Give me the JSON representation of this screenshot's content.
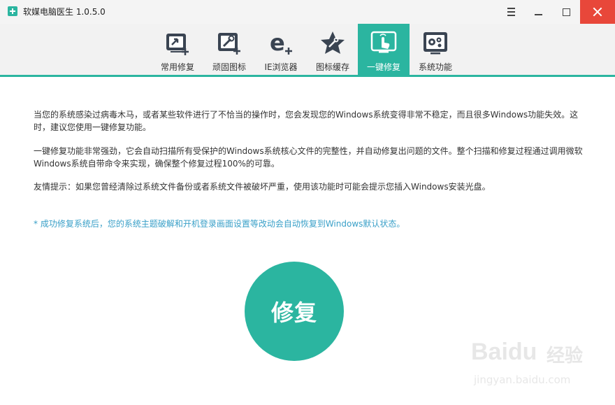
{
  "window": {
    "title": "软媒电脑医生 1.0.5.0",
    "icon": "medical-kit-icon",
    "controls": [
      "menu-icon",
      "minimize-icon",
      "maximize-icon",
      "close-icon"
    ]
  },
  "toolbar": {
    "active_tab": "一键修复",
    "accent_color": "#2bb5a0",
    "tabs": [
      {
        "label": "常用修复",
        "icon": "monitor-plus-icon"
      },
      {
        "label": "顽固图标",
        "icon": "wrench-plus-icon"
      },
      {
        "label": "IE浏览器",
        "icon": "ie-plus-icon"
      },
      {
        "label": "图标缓存",
        "icon": "star-wrench-icon"
      },
      {
        "label": "一键修复",
        "icon": "hand-click-icon"
      },
      {
        "label": "系统功能",
        "icon": "gears-icon"
      }
    ]
  },
  "content": {
    "paragraph1": "当您的系统感染过病毒木马，或者某些软件进行了不恰当的操作时，您会发现您的Windows系统变得非常不稳定，而且很多Windows功能失效。这时，建议您使用一键修复功能。",
    "paragraph2": "一键修复功能非常强劲，它会自动扫描所有受保护的Windows系统核心文件的完整性，并自动修复出问题的文件。整个扫描和修复过程通过调用微软Windows系统自带命令来实现，确保整个修复过程100%的可靠。",
    "paragraph3": "友情提示：如果您曾经清除过系统文件备份或者系统文件被破坏严重，使用该功能时可能会提示您插入Windows安装光盘。",
    "note": "* 成功修复系统后，您的系统主题破解和开机登录画面设置等改动会自动恢复到Windows默认状态。",
    "note_color": "#3aa0c8",
    "repair_button": "修复"
  },
  "watermark": {
    "brand": "Baidu",
    "brand_cn": "经验",
    "url": "jingyan.baidu.com"
  }
}
